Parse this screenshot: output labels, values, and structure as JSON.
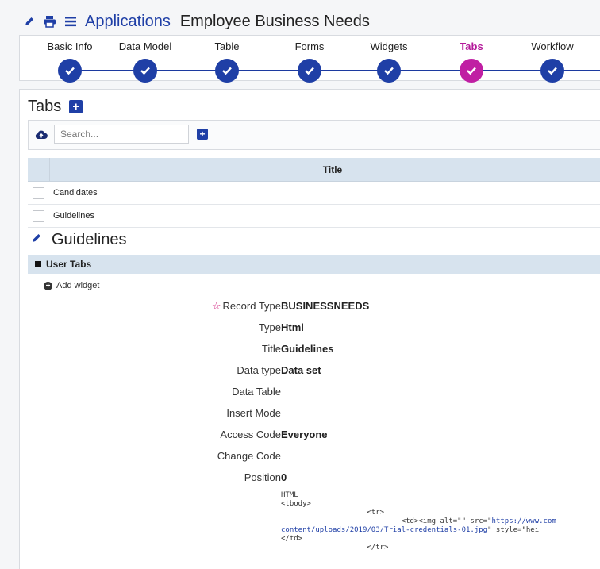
{
  "header": {
    "app_label": "Applications",
    "page_title": "Employee Business Needs",
    "icons": [
      "pencil-icon",
      "print-icon",
      "menu-icon"
    ]
  },
  "stepper": {
    "steps": [
      {
        "label": "Basic Info",
        "active": false
      },
      {
        "label": "Data Model",
        "active": false
      },
      {
        "label": "Table",
        "active": false
      },
      {
        "label": "Forms",
        "active": false
      },
      {
        "label": "Widgets",
        "active": false
      },
      {
        "label": "Tabs",
        "active": true
      },
      {
        "label": "Workflow",
        "active": false
      }
    ],
    "colors": {
      "done": "#1f3fa6",
      "active": "#c01fa3"
    }
  },
  "tabs": {
    "title": "Tabs",
    "add_icon": "plus-square-icon",
    "search_placeholder": "Search...",
    "column_title": "Title",
    "rows": [
      "Candidates",
      "Guidelines"
    ]
  },
  "detail": {
    "title": "Guidelines",
    "section": "User Tabs",
    "add_widget": "Add widget",
    "fields": [
      {
        "label": "Record Type",
        "value": "BUSINESSNEEDS",
        "required": true
      },
      {
        "label": "Type",
        "value": "Html"
      },
      {
        "label": "Title",
        "value": "Guidelines"
      },
      {
        "label": "Data type",
        "value": "Data set"
      },
      {
        "label": "Data Table",
        "value": ""
      },
      {
        "label": "Insert Mode",
        "value": ""
      },
      {
        "label": "Access Code",
        "value": "Everyone"
      },
      {
        "label": "Change Code",
        "value": ""
      },
      {
        "label": "Position",
        "value": "0"
      }
    ],
    "code": {
      "lang": "HTML",
      "line1": "<tbody>",
      "line2": "<tr>",
      "line3_prefix": "<td><img alt=\"\" src=\"",
      "line3_url": "https://www.com",
      "line4_url": "content/uploads/2019/03/Trial-credentials-01.jpg",
      "line4_suffix": "\" style=\"hei",
      "line5": "</td>",
      "line6": "</tr>"
    }
  }
}
